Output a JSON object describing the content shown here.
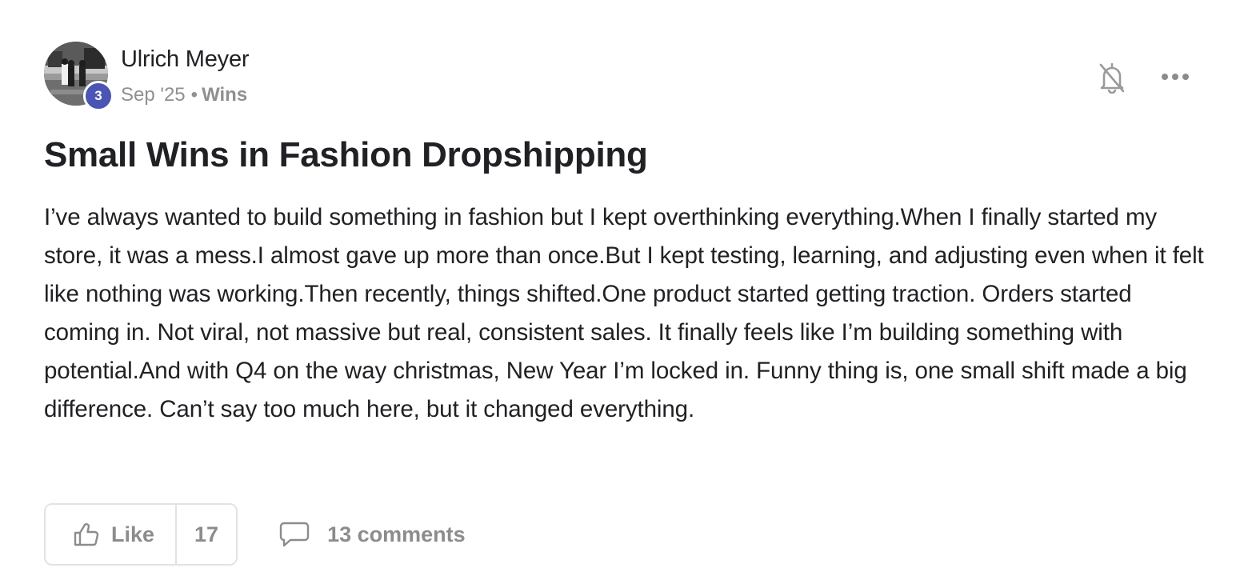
{
  "author": {
    "name": "Ulrich Meyer",
    "level": "3"
  },
  "meta": {
    "date": "Sep '25",
    "separator": "•",
    "category": "Wins"
  },
  "icons": {
    "notification": "bell-off-icon",
    "more": "more-horizontal-icon",
    "like": "thumbs-up-icon",
    "comments": "comment-bubble-icon"
  },
  "colors": {
    "level_badge": "#4a55b4",
    "muted_text": "#909090",
    "border": "#e3e3e3"
  },
  "post": {
    "title": "Small Wins in Fashion Dropshipping",
    "body": "I’ve always wanted to build something in fashion but I kept overthinking everything.When I finally started my store, it was a mess.I almost gave up more than once.But I kept testing, learning, and adjusting even when it felt like nothing was working.Then recently, things shifted.One product started getting traction. Orders started coming in. Not viral, not massive but real, consistent sales. It finally feels like I’m building something with potential.And with Q4 on the way christmas, New Year I’m locked in. Funny thing is, one small shift made a big difference. Can’t say too much here, but it changed everything."
  },
  "actions": {
    "like_label": "Like",
    "like_count": "17",
    "comments_label": "13 comments"
  }
}
